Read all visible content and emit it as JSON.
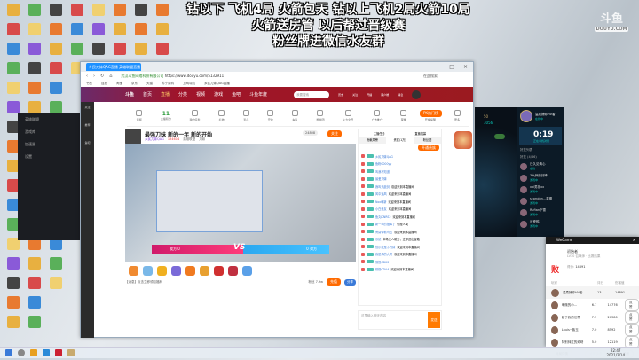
{
  "overlay": {
    "lines": [
      "钻以下 飞机4局 火箭包天 钻以上飞机2局火箭10局",
      "火箭送房管 以后帮过晋级赛",
      "粉丝牌进微信水友群"
    ],
    "logo": "斗鱼",
    "logo_sub": "DOUYU.COM"
  },
  "browser": {
    "tab_title": "乡民刀妹QAG直播 英雄联盟直播",
    "url": "https://www.douyu.com/5132911",
    "site_label": "武汉斗鱼网络科技有限公司",
    "search_hint": "在此搜索",
    "bookmarks": [
      "书签",
      "百度",
      "淘宝",
      "京东",
      "天猫",
      "苏宁易购",
      "上网导航",
      "乡民刀妹QAG直播"
    ],
    "nav": [
      "首页",
      "直播",
      "分类",
      "视频",
      "游戏",
      "鱼吧",
      "斗鱼年度"
    ],
    "nav_search": "我要搜索",
    "nav_icons": [
      "历史",
      "关注",
      "开播",
      "客户端",
      "消息"
    ],
    "sidebar": [
      "关注",
      "推荐",
      "鱼吧"
    ],
    "toolbar": [
      {
        "label": "音频"
      },
      {
        "label": "主播积分",
        "value": "11"
      },
      {
        "label": "我的任务"
      },
      {
        "label": "礼物"
      },
      {
        "label": "爱心"
      },
      {
        "label": "守护"
      },
      {
        "label": "车队"
      },
      {
        "label": "粉丝团"
      },
      {
        "label": "火力全开"
      },
      {
        "label": "广告推广"
      },
      {
        "label": "荣耀"
      },
      {
        "label": "开播提醒"
      },
      {
        "label": "更多"
      }
    ],
    "pk_button": "PK热门榜",
    "stream": {
      "title": "最强刀妹 新的一年 新的开始",
      "streamer": "乡民刀妹QAG",
      "hot": "134614",
      "follow": "关注",
      "follow_count": "24808",
      "tags": [
        "英雄联盟",
        "刀妹"
      ]
    },
    "vs": {
      "left": "我方 0",
      "right": "0 对方",
      "mid": "VS"
    },
    "footer": {
      "notice": "【消息】点击立即领取福利",
      "fans": "粉丝 7.9w",
      "recharge": "充值",
      "share": "分享"
    },
    "chat": {
      "tabs": [
        "贡献周榜",
        "贵宾(1万)",
        "粉丝团"
      ],
      "header_left": "主播任务",
      "header_right": "直播招募",
      "action": "开通贵族",
      "messages": [
        {
          "user": "乡民刀妹QAG",
          "text": ""
        },
        {
          "user": "鱼粉0000yy",
          "text": ""
        },
        {
          "user": "叫我不知道",
          "text": ""
        },
        {
          "user": "最爱刀妹",
          "text": ""
        },
        {
          "user": "我叫无敌剑",
          "text": "欢迎来到本直播间"
        },
        {
          "user": "风中追风",
          "text": "欢迎来到本直播间"
        },
        {
          "user": "Nox萌新",
          "text": "欢迎来到本直播间"
        },
        {
          "user": "小白鱼友",
          "text": "欢迎来到本直播间"
        },
        {
          "user": "鱼丸DNRS2",
          "text": "欢迎来到本直播间"
        },
        {
          "user": "新一年的指挥了",
          "text": "你是人类"
        },
        {
          "user": "黄昏带着乌云",
          "text": "欢迎来到本直播间"
        },
        {
          "user": "系统",
          "text": "本场无人助力，立即送出宝箱"
        },
        {
          "user": "快乐就是小刀妹",
          "text": "欢迎来到本直播间"
        },
        {
          "user": "我是你的大哥",
          "text": "欢迎来到本直播间"
        },
        {
          "user": "憧憬CDKS",
          "text": ""
        },
        {
          "user": "憧憬CDAA",
          "text": "欢迎来到本直播间"
        }
      ],
      "input_placeholder": "这里输入聊天内容",
      "send": "发送"
    }
  },
  "dark_panel": {
    "items": [
      "英雄联盟",
      "游戏库",
      "加速器",
      "设置"
    ]
  },
  "lol": {
    "currency1": "50",
    "currency2": "3056",
    "player": "温柔捕你HV者",
    "status": "在线中",
    "timer": "0:19",
    "timer_label": "正在寻找对局",
    "friends_header": "好友列表",
    "group": "好友 (4/86)",
    "friends": [
      {
        "name": "日久见情心",
        "status": "在线"
      },
      {
        "name": "3大师的剑锋",
        "status": "游戏中"
      },
      {
        "name": "xxi男孩xx",
        "status": "游戏中"
      },
      {
        "name": "scorpion...星期",
        "status": "游戏中"
      },
      {
        "name": "Rufian下雪",
        "status": "游戏中"
      },
      {
        "name": "可爱鸭",
        "status": "游戏中"
      }
    ]
  },
  "wegame": {
    "title": "WeGame",
    "player": "初始者",
    "level": "LV30 召唤师 · 比赛结果",
    "result": "败",
    "kda_label": "得分:",
    "kda": "14891",
    "cols": [
      "玩家",
      "评分",
      "伤害值"
    ],
    "rows": [
      {
        "name": "温柔捕你HV者",
        "score": "13.1",
        "dmg": "14891"
      },
      {
        "name": "卑微的小...",
        "score": "6.7",
        "dmg": "14776",
        "btn": "点赞"
      },
      {
        "name": "始于我的世界",
        "score": "7.5",
        "dmg": "20380",
        "btn": "点赞"
      },
      {
        "name": "Louis~紫玉",
        "score": "7.0",
        "dmg": "8592",
        "btn": "点赞"
      },
      {
        "name": "特别帅过的帅呀",
        "score": "5.0",
        "dmg": "12119",
        "btn": "点赞"
      }
    ],
    "left_btn": "对局详情",
    "mid_btn": "分享战绩",
    "right_btn": "关闭"
  },
  "taskbar": {
    "time": "22:47",
    "date": "2021/2/14"
  }
}
